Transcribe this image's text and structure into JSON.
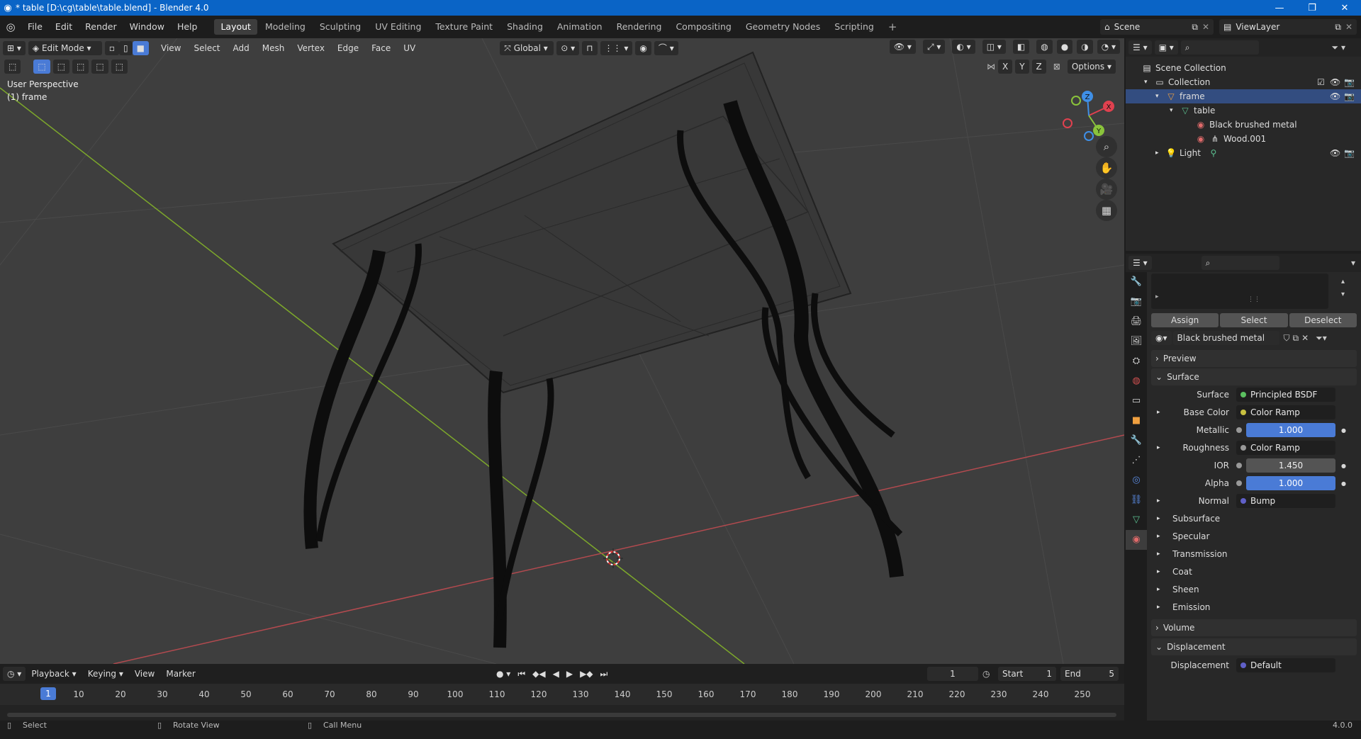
{
  "titlebar": {
    "text": "* table [D:\\cg\\table\\table.blend] - Blender 4.0"
  },
  "menu": [
    "File",
    "Edit",
    "Render",
    "Window",
    "Help"
  ],
  "workspaces": [
    "Layout",
    "Modeling",
    "Sculpting",
    "UV Editing",
    "Texture Paint",
    "Shading",
    "Animation",
    "Rendering",
    "Compositing",
    "Geometry Nodes",
    "Scripting"
  ],
  "scene": {
    "label": "Scene",
    "viewlayer": "ViewLayer"
  },
  "viewport": {
    "mode": "Edit Mode",
    "menus": [
      "View",
      "Select",
      "Add",
      "Mesh",
      "Vertex",
      "Edge",
      "Face",
      "UV"
    ],
    "orientation": "Global",
    "options": "Options",
    "axes": [
      "X",
      "Y",
      "Z"
    ],
    "info_line1": "User Perspective",
    "info_line2": "(1) frame",
    "gizmo": {
      "x": "X",
      "y": "Y",
      "z": "Z"
    }
  },
  "outliner": {
    "scene_collection": "Scene Collection",
    "collection": "Collection",
    "frame": "frame",
    "table": "table",
    "mat1": "Black brushed metal",
    "mat2": "Wood.001",
    "light": "Light"
  },
  "properties": {
    "assign": "Assign",
    "select": "Select",
    "deselect": "Deselect",
    "material_name": "Black brushed metal",
    "preview": "Preview",
    "surface_section": "Surface",
    "surface_label": "Surface",
    "surface_value": "Principled BSDF",
    "base_color_label": "Base Color",
    "base_color_value": "Color Ramp",
    "metallic_label": "Metallic",
    "metallic_value": "1.000",
    "roughness_label": "Roughness",
    "roughness_value": "Color Ramp",
    "ior_label": "IOR",
    "ior_value": "1.450",
    "alpha_label": "Alpha",
    "alpha_value": "1.000",
    "normal_label": "Normal",
    "normal_value": "Bump",
    "subsections": [
      "Subsurface",
      "Specular",
      "Transmission",
      "Coat",
      "Sheen",
      "Emission"
    ],
    "volume": "Volume",
    "displacement_section": "Displacement",
    "displacement_label": "Displacement",
    "displacement_value": "Default"
  },
  "timeline": {
    "menus": [
      "Playback",
      "Keying",
      "View",
      "Marker"
    ],
    "current_frame": "1",
    "start_label": "Start",
    "start_value": "1",
    "end_label": "End",
    "end_value": "5",
    "ticks": [
      "10",
      "20",
      "30",
      "40",
      "50",
      "60",
      "70",
      "80",
      "90",
      "100",
      "110",
      "120",
      "130",
      "140",
      "150",
      "160",
      "170",
      "180",
      "190",
      "200",
      "210",
      "220",
      "230",
      "240",
      "250"
    ],
    "cursor": "1"
  },
  "statusbar": {
    "select": "Select",
    "rotate": "Rotate View",
    "call_menu": "Call Menu",
    "version": "4.0.0"
  },
  "colors": {
    "accent": "#4a7bd6",
    "titlebar": "#0a64c6",
    "x_axis": "#e0414f",
    "y_axis": "#8ac33b",
    "z_axis": "#3f8fe6"
  }
}
